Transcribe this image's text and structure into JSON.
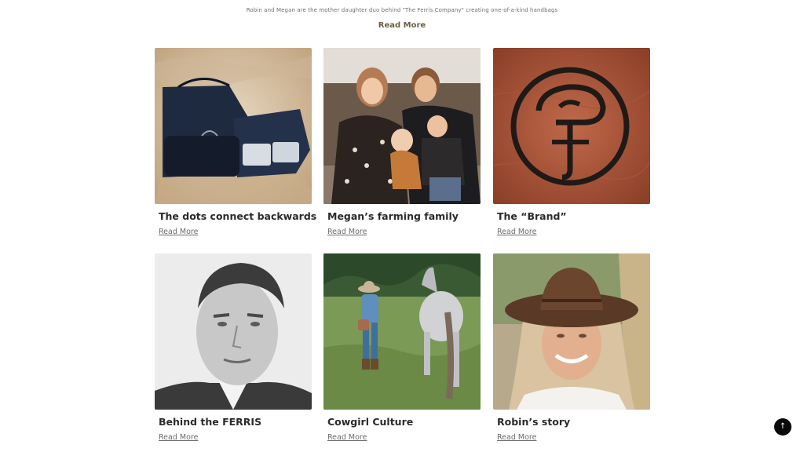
{
  "intro": {
    "text": "Robin and Megan are the mother daughter duo behind \"The Ferris Company\" creating one-of-a-kind handbags",
    "read_more": "Read More"
  },
  "cards": [
    {
      "title": "The dots connect backwards",
      "read_more": "Read More",
      "image": "black-leather-handbags-photo"
    },
    {
      "title": "Megan’s farming family",
      "read_more": "Read More",
      "image": "family-portrait-photo"
    },
    {
      "title": "The “Brand”",
      "read_more": "Read More",
      "image": "leather-brand-emblem-photo"
    },
    {
      "title": "Behind the FERRIS",
      "read_more": "Read More",
      "image": "vintage-man-portrait-photo"
    },
    {
      "title": "Cowgirl Culture",
      "read_more": "Read More",
      "image": "cowgirl-with-horse-photo"
    },
    {
      "title": "Robin’s story",
      "read_more": "Read More",
      "image": "woman-in-cowboy-hat-photo"
    }
  ],
  "scroll_top": {
    "icon": "arrow-up-icon",
    "glyph": "↑"
  }
}
